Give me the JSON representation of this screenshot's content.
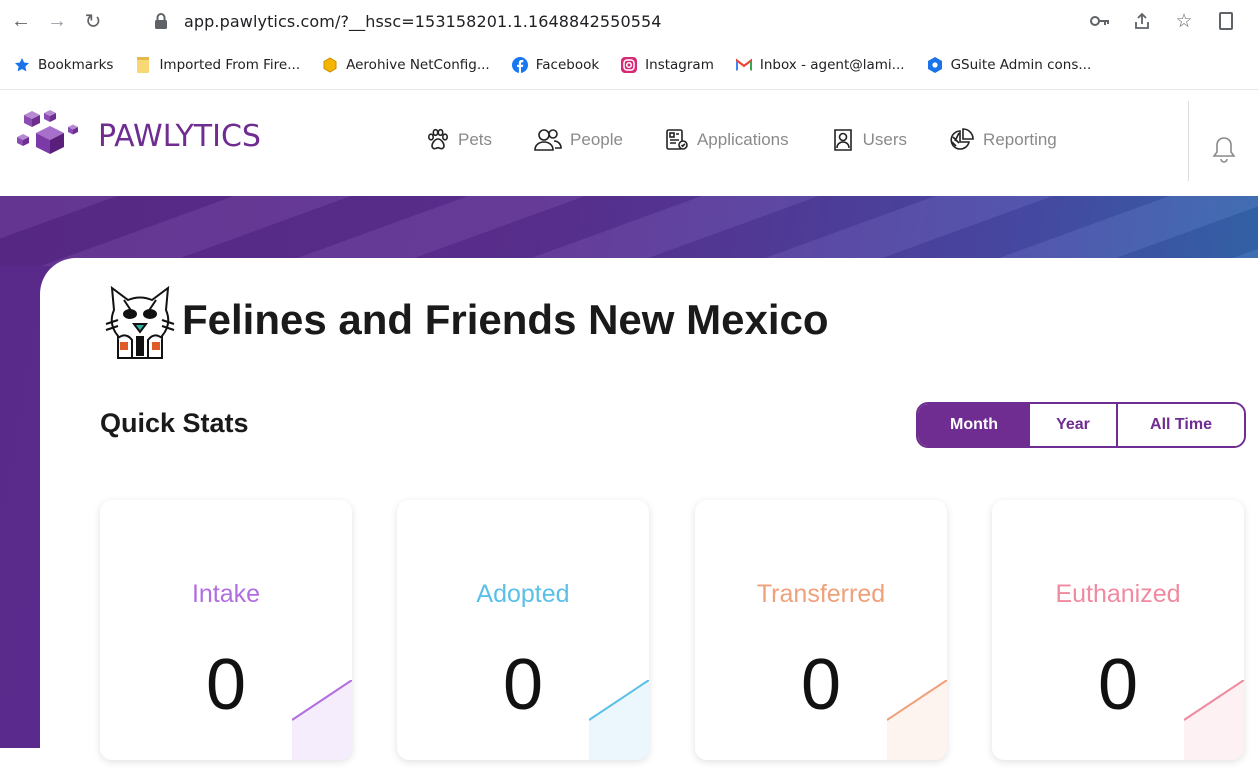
{
  "browser": {
    "url": "app.pawlytics.com/?__hssc=153158201.1.1648842550554",
    "bookmarks": [
      {
        "label": "Bookmarks",
        "icon": "star-icon"
      },
      {
        "label": "Imported From Fire...",
        "icon": "folder-icon"
      },
      {
        "label": "Aerohive NetConfig...",
        "icon": "hexagon-icon"
      },
      {
        "label": "Facebook",
        "icon": "facebook-icon"
      },
      {
        "label": "Instagram",
        "icon": "instagram-icon"
      },
      {
        "label": "Inbox - agent@lami...",
        "icon": "gmail-icon"
      },
      {
        "label": "GSuite Admin cons...",
        "icon": "gsuite-icon"
      }
    ]
  },
  "app": {
    "logo_text": "PAWLYTICS",
    "nav": [
      {
        "label": "Pets",
        "icon": "paw-icon"
      },
      {
        "label": "People",
        "icon": "people-icon"
      },
      {
        "label": "Applications",
        "icon": "document-icon"
      },
      {
        "label": "Users",
        "icon": "user-badge-icon"
      },
      {
        "label": "Reporting",
        "icon": "pie-chart-icon"
      }
    ],
    "brand_color": "#6f2c91"
  },
  "org": {
    "name": "Felines and Friends New Mexico"
  },
  "quick_stats": {
    "title": "Quick Stats",
    "periods": {
      "month": "Month",
      "year": "Year",
      "all_time": "All Time"
    },
    "selected_period": "Month",
    "cards": [
      {
        "label": "Intake",
        "value": "0",
        "color": "#b06ee0"
      },
      {
        "label": "Adopted",
        "value": "0",
        "color": "#5bc0e8"
      },
      {
        "label": "Transferred",
        "value": "0",
        "color": "#f0a07a"
      },
      {
        "label": "Euthanized",
        "value": "0",
        "color": "#f08aa0"
      }
    ]
  }
}
